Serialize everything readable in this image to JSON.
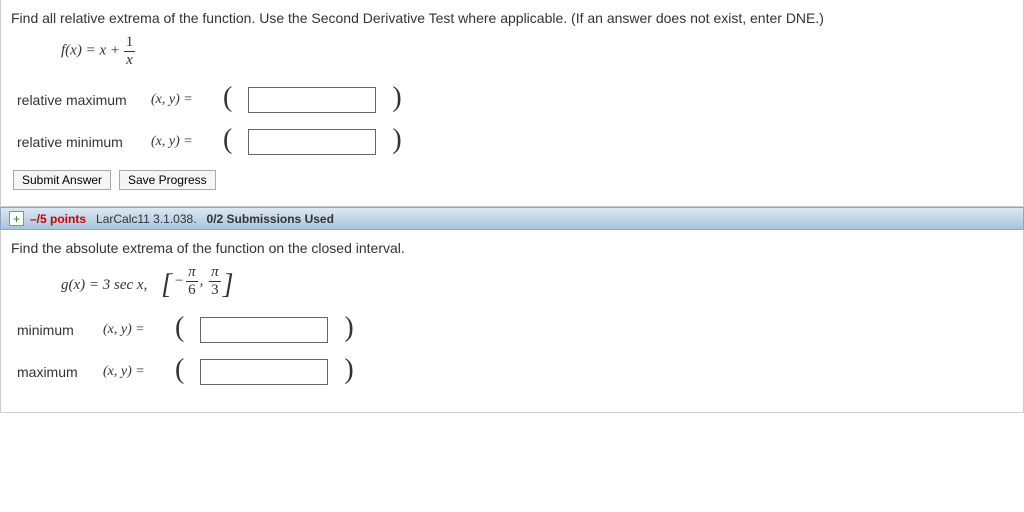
{
  "problem1": {
    "instructions": "Find all relative extrema of the function. Use the Second Derivative Test where applicable. (If an answer does not exist, enter DNE.)",
    "func_lhs": "f(x) = x +",
    "frac_num": "1",
    "frac_den": "x",
    "rows": [
      {
        "label": "relative maximum",
        "pair": "(x, y)  ="
      },
      {
        "label": "relative minimum",
        "pair": "(x, y)  ="
      }
    ],
    "buttons": {
      "submit": "Submit Answer",
      "save": "Save Progress"
    }
  },
  "header": {
    "expand_glyph": "+",
    "points": "–/5 points",
    "source": "LarCalc11 3.1.038.",
    "subs_used": "0/2 Submissions Used"
  },
  "problem2": {
    "instructions": "Find the absolute extrema of the function on the closed interval.",
    "func_lhs": "g(x) = 3 sec x,",
    "interval": {
      "lb_sign": "−",
      "lb_num": "π",
      "lb_den": "6",
      "ub_num": "π",
      "ub_den": "3"
    },
    "rows": [
      {
        "label": "minimum",
        "pair": "(x, y)  ="
      },
      {
        "label": "maximum",
        "pair": "(x, y)  ="
      }
    ]
  }
}
